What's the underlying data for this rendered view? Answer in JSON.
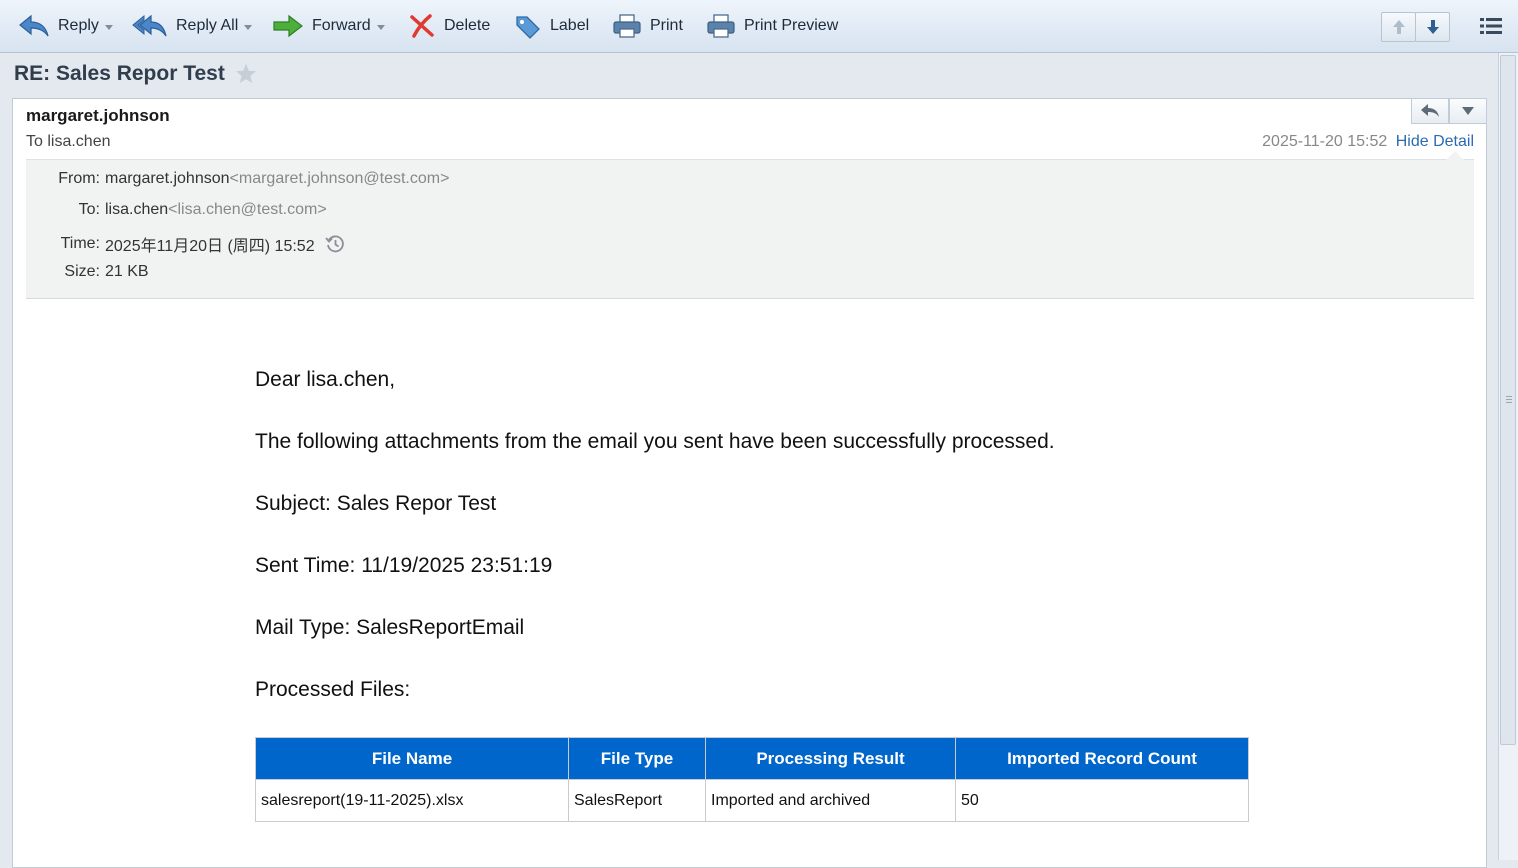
{
  "toolbar": {
    "reply": "Reply",
    "reply_all": "Reply All",
    "forward": "Forward",
    "delete": "Delete",
    "label": "Label",
    "print": "Print",
    "print_preview": "Print Preview"
  },
  "message": {
    "subject": "RE: Sales Repor Test",
    "sender": "margaret.johnson",
    "to_summary": "To lisa.chen",
    "date": "2025-11-20 15:52",
    "hide_detail": "Hide Detail"
  },
  "details": {
    "from_label": "From:",
    "from_name": "margaret.johnson",
    "from_email": "<margaret.johnson@test.com>",
    "to_label": "To:",
    "to_name": "lisa.chen",
    "to_email": "<lisa.chen@test.com>",
    "time_label": "Time:",
    "time_value": "2025年11月20日 (周四) 15:52",
    "size_label": "Size:",
    "size_value": "21 KB"
  },
  "body": {
    "greeting": "Dear lisa.chen,",
    "intro": "The following attachments from the email you sent have been successfully processed.",
    "subject_line": "Subject: Sales Repor Test",
    "sent_time": "Sent Time: 11/19/2025 23:51:19",
    "mail_type": "Mail Type: SalesReportEmail",
    "processed_files": "Processed Files:"
  },
  "files_table": {
    "headers": [
      "File Name",
      "File Type",
      "Processing Result",
      "Imported Record Count"
    ],
    "rows": [
      [
        "salesreport(19-11-2025).xlsx",
        "SalesReport",
        "Imported and archived",
        "50"
      ]
    ]
  },
  "colors": {
    "table_header": "#0066cc",
    "link": "#2a6bb2",
    "toolbar_bg": "#dfe8f2"
  }
}
